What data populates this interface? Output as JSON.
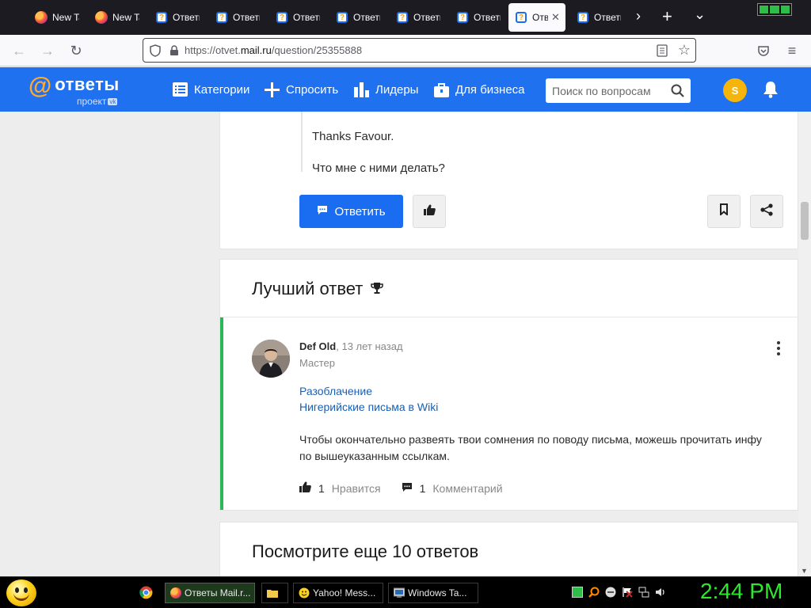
{
  "browser": {
    "tabs": [
      {
        "title": "New Tab",
        "icon": "firefox-icon"
      },
      {
        "title": "New Tab",
        "icon": "firefox-icon"
      },
      {
        "title": "Ответы Mail.ru",
        "icon": "otvety-icon"
      },
      {
        "title": "Ответы Mail.ru",
        "icon": "otvety-icon"
      },
      {
        "title": "Ответы Mail.ru",
        "icon": "otvety-icon"
      },
      {
        "title": "Ответы Mail.ru",
        "icon": "otvety-icon"
      },
      {
        "title": "Ответы Mail.ru",
        "icon": "otvety-icon"
      },
      {
        "title": "Ответы Mail.ru",
        "icon": "otvety-icon"
      },
      {
        "title": "Ответы Mail.ru",
        "icon": "otvety-icon",
        "active": true
      },
      {
        "title": "Ответы Mail.ru",
        "icon": "otvety-icon"
      }
    ],
    "url_prefix": "https://otvet.",
    "url_domain": "mail.ru",
    "url_path": "/question/25355888"
  },
  "site": {
    "logo_name": "ответы",
    "logo_sub": "проект",
    "logo_vk": "vk",
    "nav": {
      "categories": "Категории",
      "ask": "Спросить",
      "leaders": "Лидеры",
      "business": "Для бизнеса"
    },
    "search_placeholder": "Поиск по вопросам",
    "user_initial": "S"
  },
  "question": {
    "quote_line1": "Thanks Favour.",
    "quote_line2": "Что мне с ними делать?",
    "reply_label": "Ответить"
  },
  "best_answer": {
    "section_title": "Лучший ответ",
    "author": "Def Old",
    "time": "13 лет назад",
    "rank": "Мастер",
    "links": [
      "Разоблачение",
      "Нигерийские письма в Wiki"
    ],
    "text": "Чтобы окончательно развеять твои сомнения по поводу письма, можешь прочитать инфу по вышеуказанным ссылкам.",
    "likes_count": "1",
    "likes_label": "Нравится",
    "comments_count": "1",
    "comments_label": "Комментарий"
  },
  "more": {
    "title": "Посмотрите еще 10 ответов"
  },
  "taskbar": {
    "items": [
      {
        "label": "Ответы Mail.r..."
      },
      {
        "label": ""
      },
      {
        "label": "Yahoo! Mess..."
      },
      {
        "label": "Windows Ta..."
      }
    ],
    "clock": "2:44 PM"
  },
  "colors": {
    "brand_blue": "#1f71f0",
    "best_answer_green": "#2bb65a",
    "logo_orange": "#ffa930",
    "clock_green": "#2ee82e"
  }
}
